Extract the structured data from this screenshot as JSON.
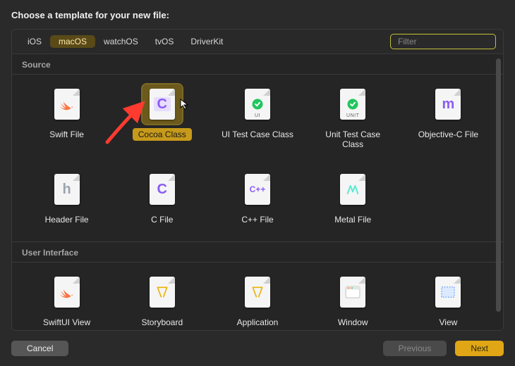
{
  "title": "Choose a template for your new file:",
  "platforms": [
    {
      "id": "ios",
      "label": "iOS",
      "active": false
    },
    {
      "id": "macos",
      "label": "macOS",
      "active": true
    },
    {
      "id": "watchos",
      "label": "watchOS",
      "active": false
    },
    {
      "id": "tvos",
      "label": "tvOS",
      "active": false
    },
    {
      "id": "driverkit",
      "label": "DriverKit",
      "active": false
    }
  ],
  "filter_placeholder": "Filter",
  "sections": {
    "source": "Source",
    "ui": "User Interface"
  },
  "items": {
    "swift_file": "Swift File",
    "cocoa_class": "Cocoa Class",
    "ui_test": "UI Test Case Class",
    "unit_test": "Unit Test Case Class",
    "objc": "Objective-C File",
    "header": "Header File",
    "c_file": "C File",
    "cpp_file": "C++ File",
    "metal": "Metal File",
    "swiftui": "SwiftUI View",
    "storyboard": "Storyboard",
    "application": "Application",
    "window": "Window",
    "view": "View"
  },
  "icon_labels": {
    "ui_sub": "UI",
    "unit_sub": "UNIT"
  },
  "buttons": {
    "cancel": "Cancel",
    "previous": "Previous",
    "next": "Next"
  },
  "selected": "cocoa_class",
  "colors": {
    "swift": "#fa7343",
    "purple": "#8b5cf6",
    "green": "#22c55e",
    "teal": "#5eead4",
    "yellow": "#eab308",
    "blue": "#3b82f6",
    "accent": "#e0a615"
  }
}
